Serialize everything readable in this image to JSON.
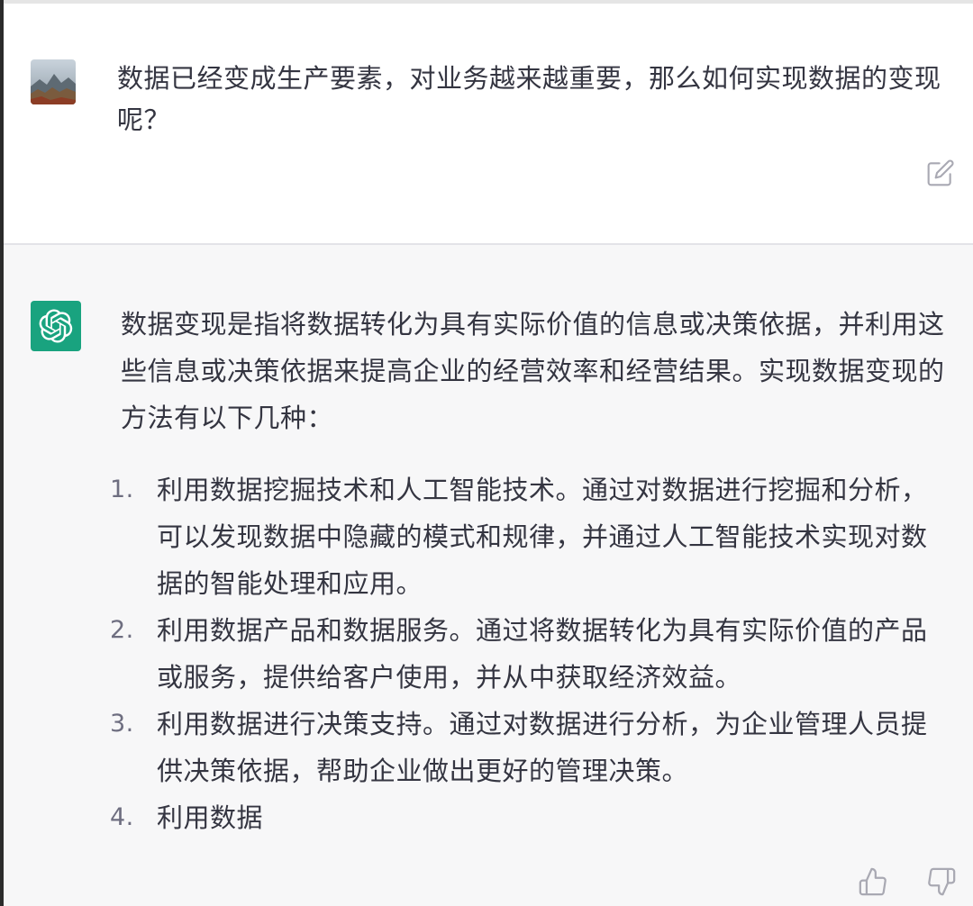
{
  "user_message": {
    "text": "数据已经变成生产要素，对业务越来越重要，那么如何实现数据的变现呢？"
  },
  "assistant_message": {
    "intro": "数据变现是指将数据转化为具有实际价值的信息或决策依据，并利用这些信息或决策依据来提高企业的经营效率和经营结果。实现数据变现的方法有以下几种：",
    "items": [
      {
        "num": "1.",
        "text": "利用数据挖掘技术和人工智能技术。通过对数据进行挖掘和分析，可以发现数据中隐藏的模式和规律，并通过人工智能技术实现对数据的智能处理和应用。"
      },
      {
        "num": "2.",
        "text": "利用数据产品和数据服务。通过将数据转化为具有实际价值的产品或服务，提供给客户使用，并从中获取经济效益。"
      },
      {
        "num": "3.",
        "text": "利用数据进行决策支持。通过对数据进行分析，为企业管理人员提供决策依据，帮助企业做出更好的管理决策。"
      },
      {
        "num": "4.",
        "text": "利用数据"
      }
    ]
  },
  "icons": {
    "edit": "edit-icon",
    "thumb_up": "thumbs-up-icon",
    "thumb_down": "thumbs-down-icon",
    "assistant_logo": "openai-logo-icon"
  },
  "colors": {
    "assistant_bg": "#f7f7f8",
    "assistant_logo_bg": "#19a37f",
    "text": "#343541",
    "icon": "#a9a9b3"
  }
}
